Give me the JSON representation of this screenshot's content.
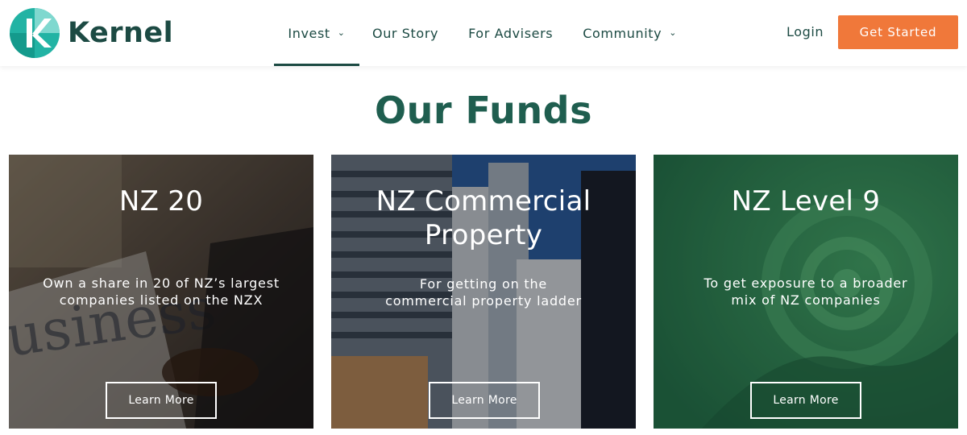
{
  "brand": {
    "name": "Kernel"
  },
  "nav": {
    "items": [
      {
        "label": "Invest",
        "has_dropdown": true,
        "active": true
      },
      {
        "label": "Our Story",
        "has_dropdown": false
      },
      {
        "label": "For Advisers",
        "has_dropdown": false
      },
      {
        "label": "Community",
        "has_dropdown": true
      }
    ],
    "dropdown_icon": "chevron-down-icon"
  },
  "header": {
    "login_label": "Login",
    "cta_label": "Get Started"
  },
  "main": {
    "title": "Our Funds"
  },
  "funds": [
    {
      "title": "NZ 20",
      "description_lines": [
        "Own a share in 20 of NZ’s largest",
        "companies listed on the NZX"
      ],
      "button_label": "Learn More"
    },
    {
      "title_lines": [
        "NZ Commercial",
        "Property"
      ],
      "description_lines": [
        "For getting on the",
        "commercial property ladder"
      ],
      "button_label": "Learn More"
    },
    {
      "title": "NZ Level 9",
      "description_lines": [
        "To get exposure to a broader",
        "mix of NZ companies"
      ],
      "button_label": "Learn More"
    }
  ],
  "colors": {
    "brand_green": "#1c4a43",
    "title_green": "#1f5e4f",
    "cta_orange": "#f0783a",
    "logo_teal": "#2bb5a8",
    "card3_green": "#2b6d47"
  }
}
